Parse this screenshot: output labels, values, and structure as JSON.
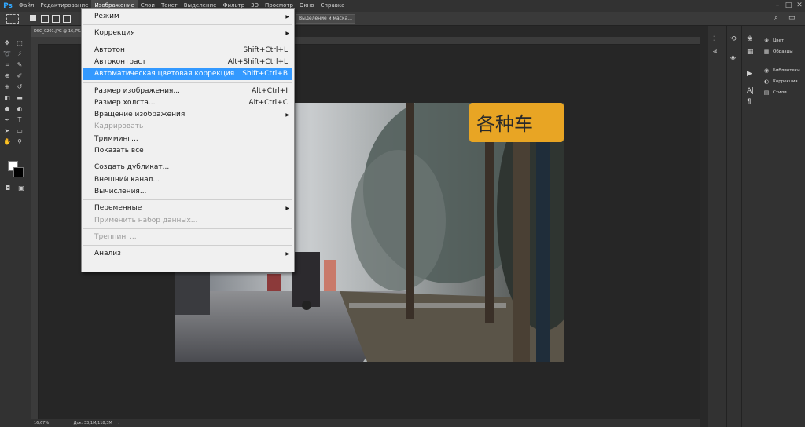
{
  "app": {
    "logo": "Ps"
  },
  "menubar": {
    "items": [
      "Файл",
      "Редактирование",
      "Изображение",
      "Слои",
      "Текст",
      "Выделение",
      "Фильтр",
      "3D",
      "Просмотр",
      "Окно",
      "Справка"
    ],
    "active": "Изображение",
    "window_controls": [
      "–",
      "□",
      "✕"
    ]
  },
  "options_bar": {
    "mask_button": "Выделение и маска...",
    "right_icons": [
      "search-icon",
      "workspace-icon"
    ]
  },
  "document": {
    "tab_title": "DSC_0201.JPG @ 16,7% (RGB/8)",
    "zoom": "16,67%",
    "doc_size": "Док: 33,1М/118,3М"
  },
  "image_menu": {
    "items": [
      {
        "label": "Режим",
        "submenu": true
      },
      {
        "sep": true
      },
      {
        "label": "Коррекция",
        "submenu": true
      },
      {
        "sep": true
      },
      {
        "label": "Автотон",
        "shortcut": "Shift+Ctrl+L"
      },
      {
        "label": "Автоконтраст",
        "shortcut": "Alt+Shift+Ctrl+L"
      },
      {
        "label": "Автоматическая цветовая коррекция",
        "shortcut": "Shift+Ctrl+B",
        "highlighted": true
      },
      {
        "sep": true
      },
      {
        "label": "Размер изображения...",
        "shortcut": "Alt+Ctrl+I"
      },
      {
        "label": "Размер холста...",
        "shortcut": "Alt+Ctrl+C"
      },
      {
        "label": "Вращение изображения",
        "submenu": true
      },
      {
        "label": "Кадрировать",
        "disabled": true
      },
      {
        "label": "Тримминг..."
      },
      {
        "label": "Показать все"
      },
      {
        "sep": true
      },
      {
        "label": "Создать дубликат..."
      },
      {
        "label": "Внешний канал..."
      },
      {
        "label": "Вычисления..."
      },
      {
        "sep": true
      },
      {
        "label": "Переменные",
        "submenu": true
      },
      {
        "label": "Применить набор данных...",
        "disabled": true
      },
      {
        "sep": true
      },
      {
        "label": "Треппинг...",
        "disabled": true
      },
      {
        "sep": true
      },
      {
        "label": "Анализ",
        "submenu": true
      }
    ]
  },
  "photo": {
    "sign_text": "各种车"
  },
  "panels": {
    "group1": [
      {
        "label": "Цвет",
        "icon": "color-icon"
      },
      {
        "label": "Образцы",
        "icon": "swatches-icon"
      }
    ],
    "group2": [
      {
        "label": "Библиотеки",
        "icon": "libraries-icon"
      },
      {
        "label": "Коррекция",
        "icon": "adjustments-icon"
      },
      {
        "label": "Стили",
        "icon": "styles-icon"
      }
    ]
  },
  "colors": {
    "highlight": "#3399ff",
    "menu_bg": "#f0f0f0",
    "app_bg": "#282828",
    "ps_blue": "#31a8ff"
  }
}
